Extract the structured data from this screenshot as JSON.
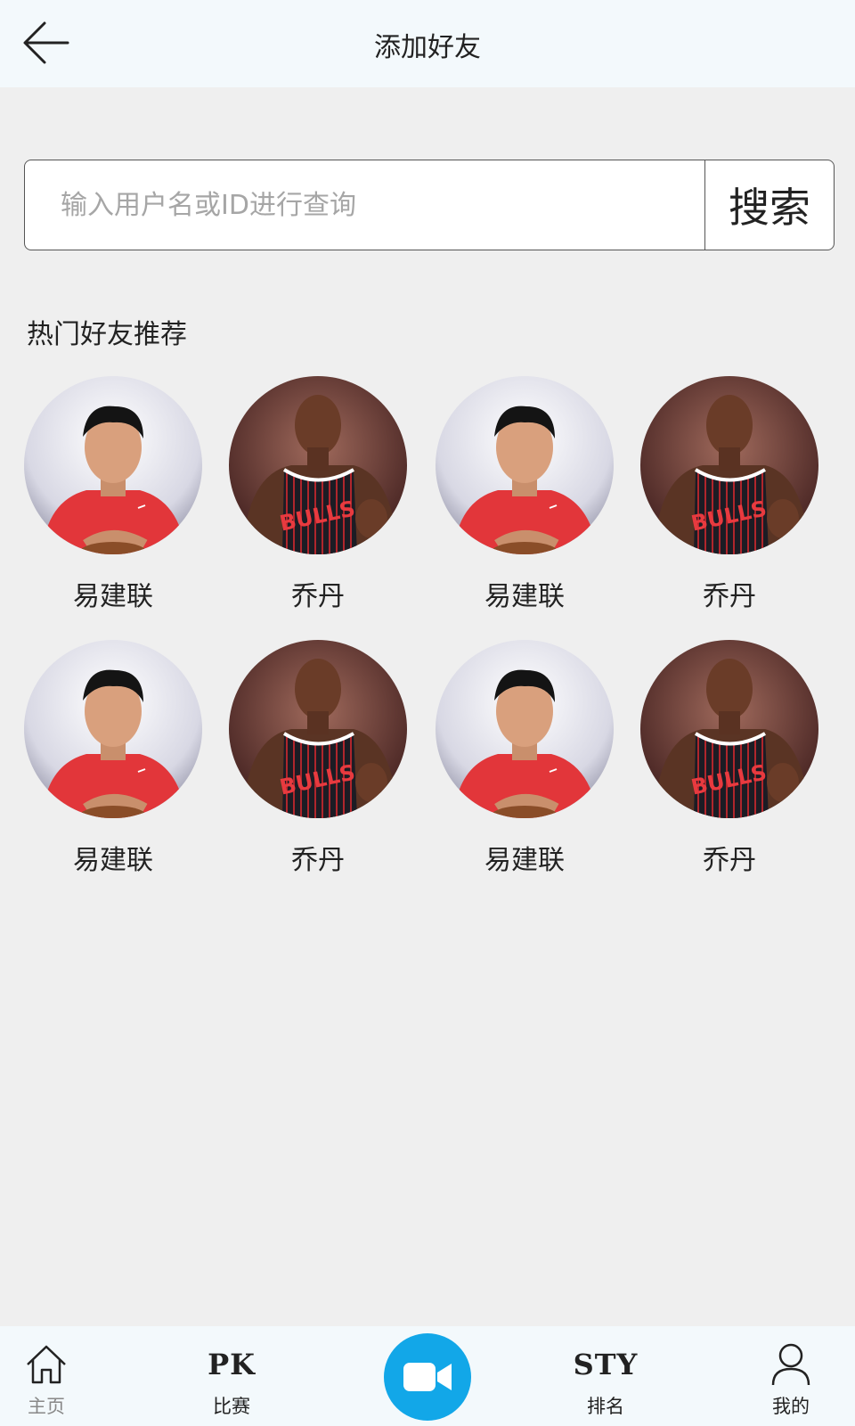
{
  "header": {
    "title": "添加好友",
    "back_icon": "arrow-left-icon"
  },
  "search": {
    "placeholder": "输入用户名或ID进行查询",
    "value": "",
    "button_label": "搜索"
  },
  "section": {
    "title": "热门好友推荐"
  },
  "friends": [
    {
      "name": "易建联",
      "avatar": "player-red-shirt"
    },
    {
      "name": "乔丹",
      "avatar": "player-bulls-jersey"
    },
    {
      "name": "易建联",
      "avatar": "player-red-shirt"
    },
    {
      "name": "乔丹",
      "avatar": "player-bulls-jersey"
    },
    {
      "name": "易建联",
      "avatar": "player-red-shirt"
    },
    {
      "name": "乔丹",
      "avatar": "player-bulls-jersey"
    },
    {
      "name": "易建联",
      "avatar": "player-red-shirt"
    },
    {
      "name": "乔丹",
      "avatar": "player-bulls-jersey"
    }
  ],
  "tabbar": {
    "items": [
      {
        "label": "主页",
        "icon": "home-icon"
      },
      {
        "label": "比赛",
        "icon_text": "PK"
      },
      {
        "label": "",
        "icon": "video-camera-icon"
      },
      {
        "label": "排名",
        "icon_text": "STY"
      },
      {
        "label": "我的",
        "icon": "user-icon"
      }
    ]
  },
  "colors": {
    "accent": "#12a7e8",
    "header_bg": "#f3f9fc",
    "page_bg": "#efefef"
  }
}
